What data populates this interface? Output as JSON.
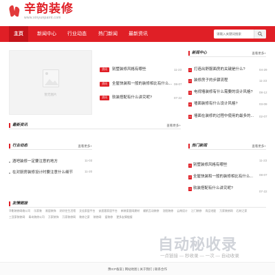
{
  "header": {
    "logo_title": "辛韵装修",
    "logo_sub": "www.xinyunpaint.com"
  },
  "nav": {
    "items": [
      "主页",
      "新闻中心",
      "行业动态",
      "热门新闻",
      "最新资讯"
    ],
    "active": 0,
    "search_placeholder": "请输入关键词搜索"
  },
  "photo": {
    "caption": "暂无图片"
  },
  "featured": [
    {
      "tag": "资讯",
      "title": "别墅装修风格有哪些",
      "date": "11-23"
    },
    {
      "tag": "资讯",
      "title": "全屋快装和一般的装修相比有什么...",
      "date": "08-07"
    },
    {
      "tag": "资讯",
      "title": "软装搭配有什么讲究呢?",
      "date": "07-22"
    }
  ],
  "news_center": {
    "title": "新闻中心",
    "more": "查看更多+",
    "items": [
      {
        "num": "1",
        "title": "打造出舒服面房的关键是什么?",
        "date": "04-29"
      },
      {
        "num": "2",
        "title": "装修房子的步骤流程",
        "date": "11-23"
      },
      {
        "num": "3",
        "title": "电视墙装修有什么需要的设计风格?",
        "date": "08-12"
      },
      {
        "num": "4",
        "title": "墙面装修有什么设计风格?",
        "date": "03-09"
      },
      {
        "num": "5",
        "title": "墙面在装修的过程中使用的最多的...",
        "date": "02-07"
      }
    ]
  },
  "latest": {
    "title": "最新资讯",
    "more": "查看更多+"
  },
  "industry": {
    "title": "行业动态",
    "more": "查看更多+",
    "items": [
      {
        "title": "酒吧装修一定要注意的地方",
        "date": "11-03"
      },
      {
        "title": "在对厨房装修设计时要注意什么细节",
        "date": "11-20"
      }
    ]
  },
  "hot": {
    "title": "热门新闻",
    "more": "查看更多+",
    "items": [
      {
        "num": "1",
        "title": "别墅装修风格有哪些",
        "date": "11-23"
      },
      {
        "num": "2",
        "title": "全屋快装和一般的装修相比有什么...",
        "date": "08-07"
      },
      {
        "num": "3",
        "title": "软装搭配有什么讲究呢?",
        "date": "07-22"
      }
    ]
  },
  "friend_links": {
    "title": "友情链接",
    "items": [
      "华影装修网络公司",
      "乐家装",
      "易居装饰",
      "好好住生活馆",
      "艾佳家居平台",
      "安居客家居平台",
      "新装家居网建材",
      "顺帆互动装修",
      "沈阳装修",
      "云南设计",
      "江门装修",
      "尚品宅配",
      "万家装修网",
      "石材之家",
      "三亚家装修网",
      "青岛装修公司",
      "万家装饰",
      "万家装修网",
      "装修之家",
      "装修网",
      "爱装修",
      "更多友情链接"
    ]
  },
  "watermark": {
    "logo": "自动秘收录",
    "tagline": "一点链接 — 秒收录 — 一次 — 自动收录"
  },
  "footer": "豫ICP备案 | 网站地图 | 关于我们 | 联系合作"
}
